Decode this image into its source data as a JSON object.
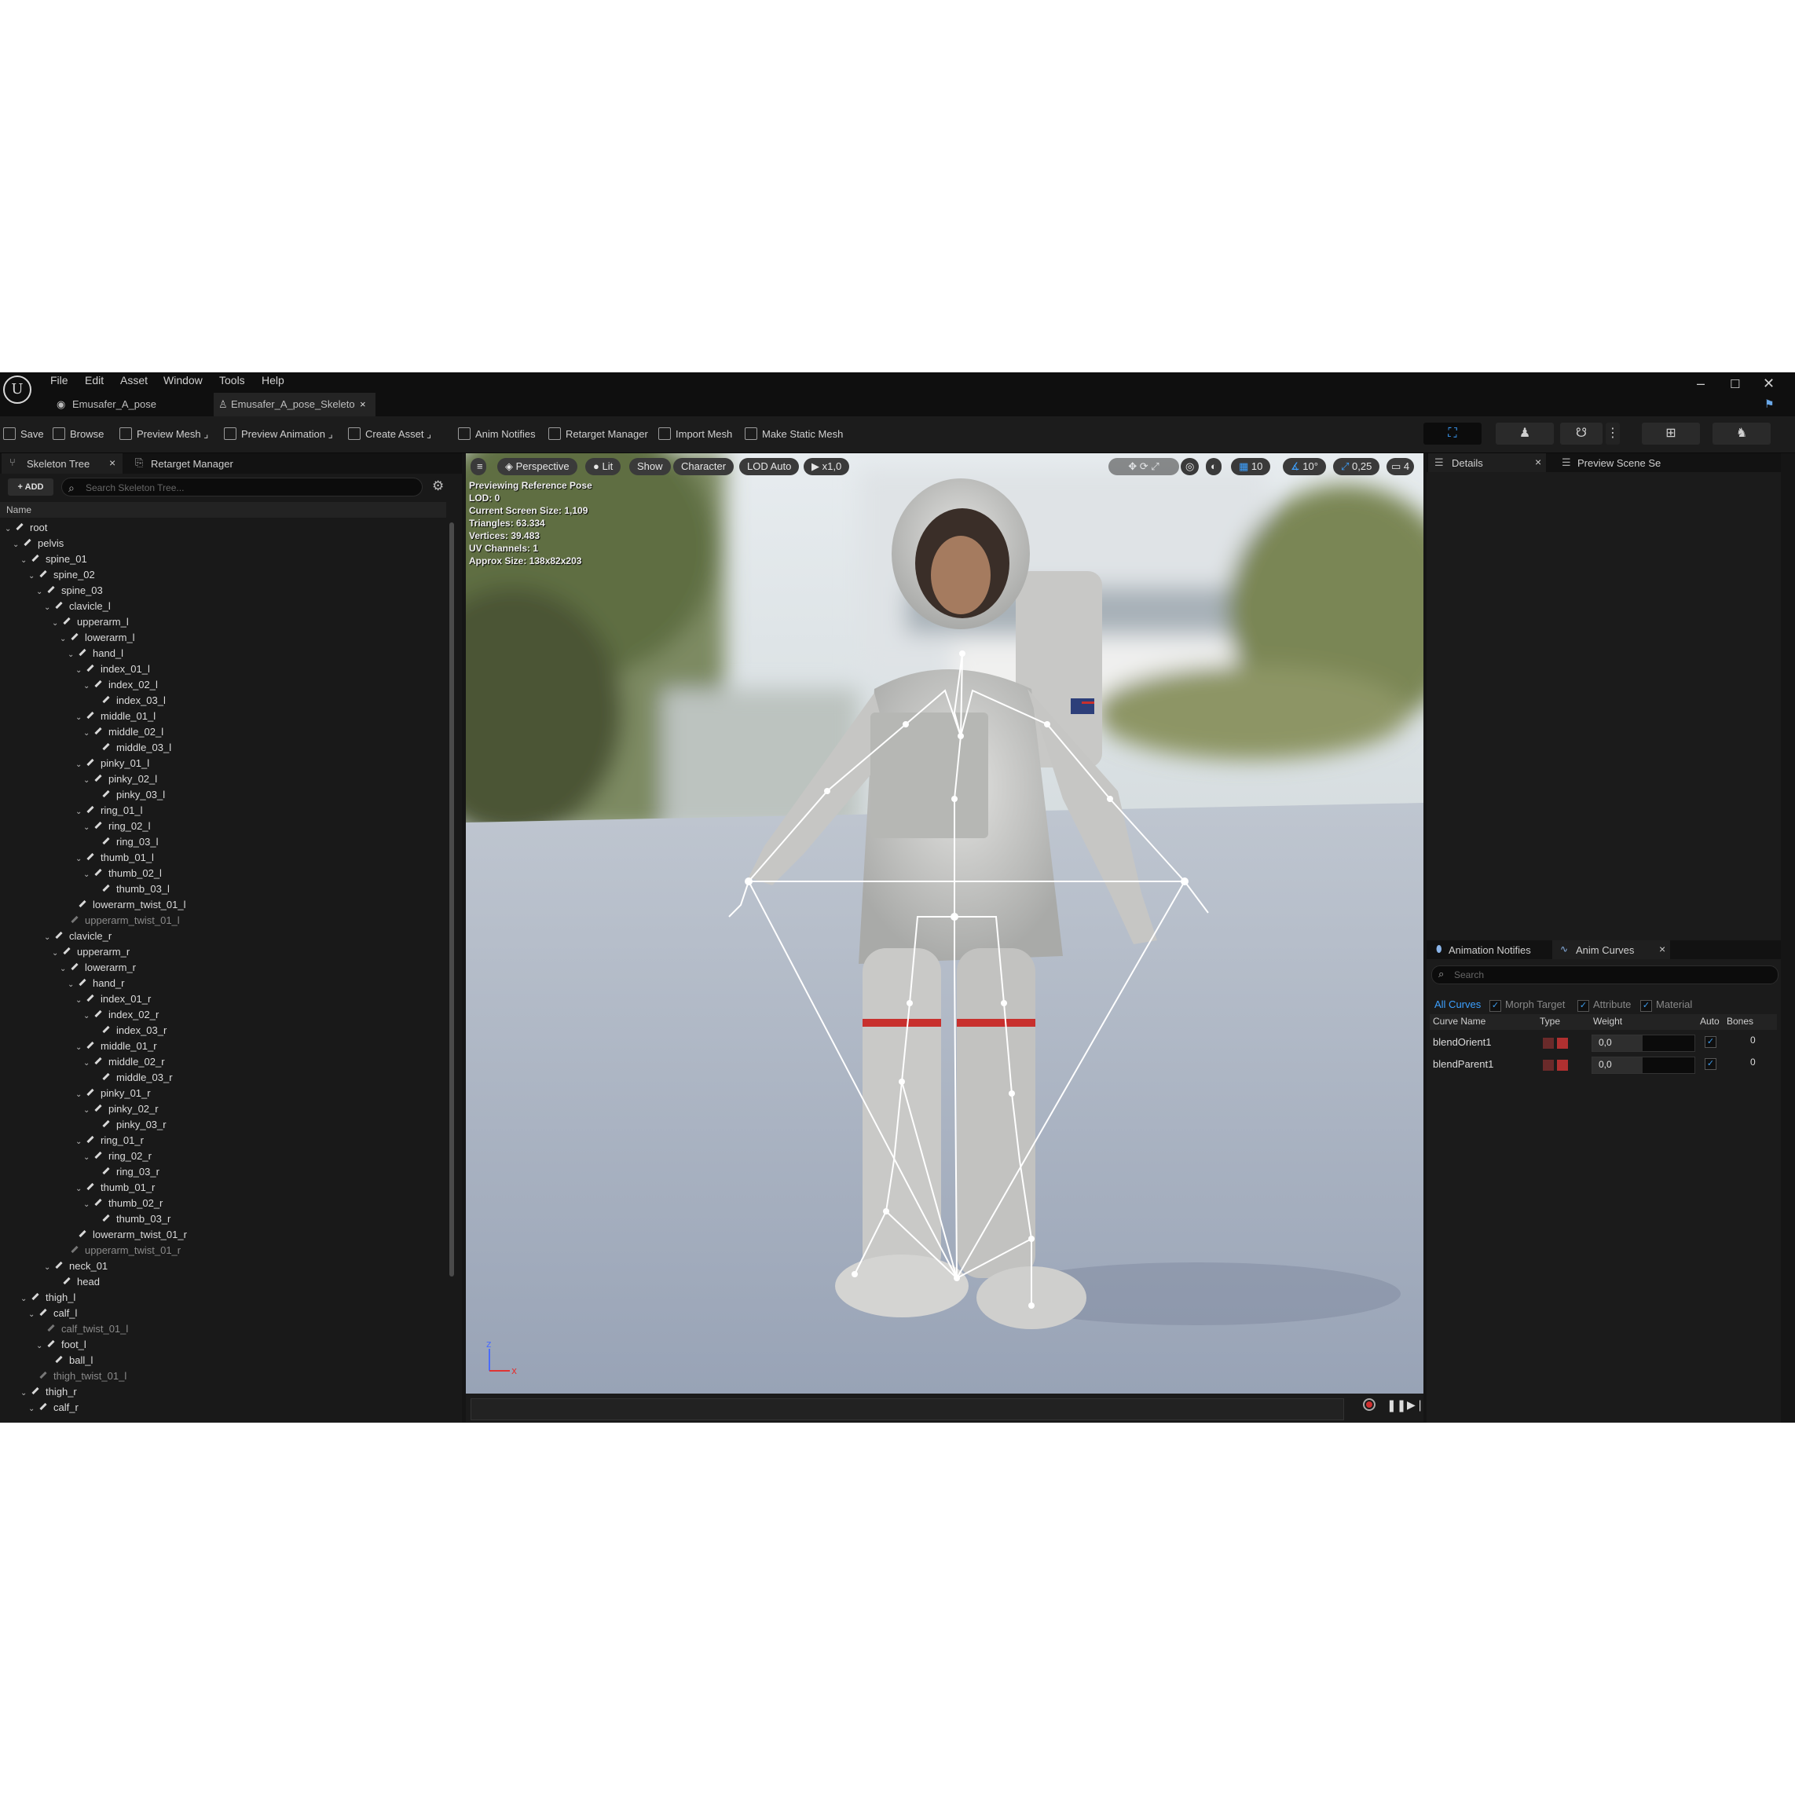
{
  "menu": [
    "File",
    "Edit",
    "Asset",
    "Window",
    "Tools",
    "Help"
  ],
  "doc_tabs": [
    "Emusafer_A_pose",
    "Emusafer_A_pose_Skeleto"
  ],
  "toolbar": {
    "save": "Save",
    "browse": "Browse",
    "preview_mesh": "Preview Mesh",
    "preview_animation": "Preview Animation",
    "create_asset": "Create Asset",
    "anim_notifies": "Anim Notifies",
    "retarget_manager": "Retarget Manager",
    "import_mesh": "Import Mesh",
    "make_static_mesh": "Make Static Mesh"
  },
  "left_panel": {
    "tab_skeleton_tree": "Skeleton Tree",
    "tab_retarget_manager": "Retarget Manager",
    "add_label": "ADD",
    "search_placeholder": "Search Skeleton Tree...",
    "column_name": "Name",
    "tree": [
      {
        "label": "root",
        "depth": 0,
        "expanded": true
      },
      {
        "label": "pelvis",
        "depth": 1,
        "expanded": true
      },
      {
        "label": "spine_01",
        "depth": 2,
        "expanded": true
      },
      {
        "label": "spine_02",
        "depth": 3,
        "expanded": true
      },
      {
        "label": "spine_03",
        "depth": 4,
        "expanded": true
      },
      {
        "label": "clavicle_l",
        "depth": 5,
        "expanded": true
      },
      {
        "label": "upperarm_l",
        "depth": 6,
        "expanded": true
      },
      {
        "label": "lowerarm_l",
        "depth": 7,
        "expanded": true
      },
      {
        "label": "hand_l",
        "depth": 8,
        "expanded": true
      },
      {
        "label": "index_01_l",
        "depth": 9,
        "expanded": true
      },
      {
        "label": "index_02_l",
        "depth": 10,
        "expanded": true
      },
      {
        "label": "index_03_l",
        "depth": 11
      },
      {
        "label": "middle_01_l",
        "depth": 9,
        "expanded": true
      },
      {
        "label": "middle_02_l",
        "depth": 10,
        "expanded": true
      },
      {
        "label": "middle_03_l",
        "depth": 11
      },
      {
        "label": "pinky_01_l",
        "depth": 9,
        "expanded": true
      },
      {
        "label": "pinky_02_l",
        "depth": 10,
        "expanded": true
      },
      {
        "label": "pinky_03_l",
        "depth": 11
      },
      {
        "label": "ring_01_l",
        "depth": 9,
        "expanded": true
      },
      {
        "label": "ring_02_l",
        "depth": 10,
        "expanded": true
      },
      {
        "label": "ring_03_l",
        "depth": 11
      },
      {
        "label": "thumb_01_l",
        "depth": 9,
        "expanded": true
      },
      {
        "label": "thumb_02_l",
        "depth": 10,
        "expanded": true
      },
      {
        "label": "thumb_03_l",
        "depth": 11
      },
      {
        "label": "lowerarm_twist_01_l",
        "depth": 8
      },
      {
        "label": "upperarm_twist_01_l",
        "depth": 7,
        "dim": true
      },
      {
        "label": "clavicle_r",
        "depth": 5,
        "expanded": true
      },
      {
        "label": "upperarm_r",
        "depth": 6,
        "expanded": true
      },
      {
        "label": "lowerarm_r",
        "depth": 7,
        "expanded": true
      },
      {
        "label": "hand_r",
        "depth": 8,
        "expanded": true
      },
      {
        "label": "index_01_r",
        "depth": 9,
        "expanded": true
      },
      {
        "label": "index_02_r",
        "depth": 10,
        "expanded": true
      },
      {
        "label": "index_03_r",
        "depth": 11
      },
      {
        "label": "middle_01_r",
        "depth": 9,
        "expanded": true
      },
      {
        "label": "middle_02_r",
        "depth": 10,
        "expanded": true
      },
      {
        "label": "middle_03_r",
        "depth": 11
      },
      {
        "label": "pinky_01_r",
        "depth": 9,
        "expanded": true
      },
      {
        "label": "pinky_02_r",
        "depth": 10,
        "expanded": true
      },
      {
        "label": "pinky_03_r",
        "depth": 11
      },
      {
        "label": "ring_01_r",
        "depth": 9,
        "expanded": true
      },
      {
        "label": "ring_02_r",
        "depth": 10,
        "expanded": true
      },
      {
        "label": "ring_03_r",
        "depth": 11
      },
      {
        "label": "thumb_01_r",
        "depth": 9,
        "expanded": true
      },
      {
        "label": "thumb_02_r",
        "depth": 10,
        "expanded": true
      },
      {
        "label": "thumb_03_r",
        "depth": 11
      },
      {
        "label": "lowerarm_twist_01_r",
        "depth": 8
      },
      {
        "label": "upperarm_twist_01_r",
        "depth": 7,
        "dim": true
      },
      {
        "label": "neck_01",
        "depth": 5,
        "expanded": true
      },
      {
        "label": "head",
        "depth": 6
      },
      {
        "label": "thigh_l",
        "depth": 2,
        "expanded": true
      },
      {
        "label": "calf_l",
        "depth": 3,
        "expanded": true
      },
      {
        "label": "calf_twist_01_l",
        "depth": 4,
        "dim": true
      },
      {
        "label": "foot_l",
        "depth": 4,
        "expanded": true
      },
      {
        "label": "ball_l",
        "depth": 5
      },
      {
        "label": "thigh_twist_01_l",
        "depth": 3,
        "dim": true
      },
      {
        "label": "thigh_r",
        "depth": 2,
        "expanded": true
      },
      {
        "label": "calf_r",
        "depth": 3,
        "expanded": true
      }
    ]
  },
  "viewport": {
    "perspective": "Perspective",
    "lit": "Lit",
    "show": "Show",
    "character": "Character",
    "lod": "LOD Auto",
    "speed": "x1,0",
    "grid_snap": "10",
    "angle_snap": "10°",
    "scale_snap": "0,25",
    "camera_speed": "4",
    "stats": [
      "Previewing Reference Pose",
      "LOD: 0",
      "Current Screen Size: 1,109",
      "Triangles: 63.334",
      "Vertices: 39.483",
      "UV Channels: 1",
      "Approx Size: 138x82x203"
    ],
    "axis_z": "z",
    "axis_x": "x"
  },
  "right_top": {
    "tab_details": "Details",
    "tab_preview_scene": "Preview Scene Se"
  },
  "right_bottom": {
    "tab_animation_notifies": "Animation Notifies",
    "tab_anim_curves": "Anim Curves",
    "search_placeholder": "Search",
    "filters": {
      "all": "All Curves",
      "morph": "Morph Target",
      "attribute": "Attribute",
      "material": "Material"
    },
    "columns": {
      "name": "Curve Name",
      "type": "Type",
      "weight": "Weight",
      "auto": "Auto",
      "bones": "Bones"
    },
    "rows": [
      {
        "name": "blendOrient1",
        "weight": "0,0",
        "bones": "0"
      },
      {
        "name": "blendParent1",
        "weight": "0,0",
        "bones": "0"
      }
    ]
  },
  "colors": {
    "accent": "#3ca0ff",
    "panel": "#1b1b1b",
    "background": "#151515"
  }
}
